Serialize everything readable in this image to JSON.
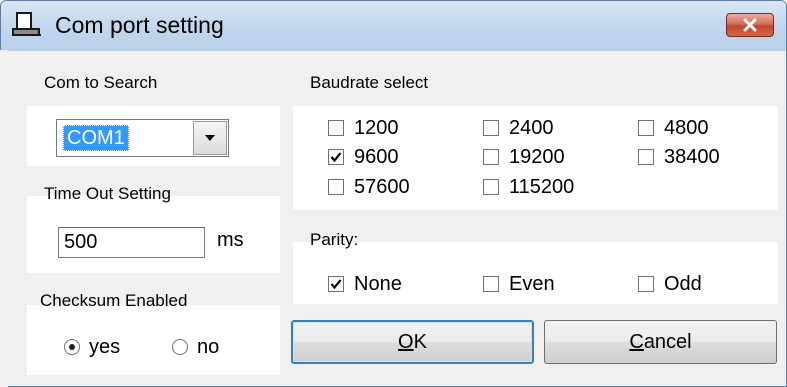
{
  "window": {
    "title": "Com port setting",
    "icon": "computer-icon",
    "close_icon": "close-x-icon"
  },
  "com_search": {
    "label": "Com to Search",
    "selected": "COM1",
    "dropdown_icon": "chevron-down-icon"
  },
  "timeout": {
    "label": "Time Out Setting",
    "value": "500",
    "unit": "ms"
  },
  "checksum": {
    "label": "Checksum Enabled",
    "options": [
      {
        "label": "yes",
        "selected": true
      },
      {
        "label": "no",
        "selected": false
      }
    ]
  },
  "baudrate": {
    "label": "Baudrate select",
    "options": [
      {
        "label": "1200",
        "checked": false
      },
      {
        "label": "2400",
        "checked": false
      },
      {
        "label": "4800",
        "checked": false
      },
      {
        "label": "9600",
        "checked": true
      },
      {
        "label": "19200",
        "checked": false
      },
      {
        "label": "38400",
        "checked": false
      },
      {
        "label": "57600",
        "checked": false
      },
      {
        "label": "115200",
        "checked": false
      }
    ]
  },
  "parity": {
    "label": "Parity:",
    "options": [
      {
        "label": "None",
        "checked": true
      },
      {
        "label": "Even",
        "checked": false
      },
      {
        "label": "Odd",
        "checked": false
      }
    ]
  },
  "buttons": {
    "ok_prefix": "O",
    "ok_rest": "K",
    "cancel_prefix": "C",
    "cancel_rest": "ancel"
  }
}
